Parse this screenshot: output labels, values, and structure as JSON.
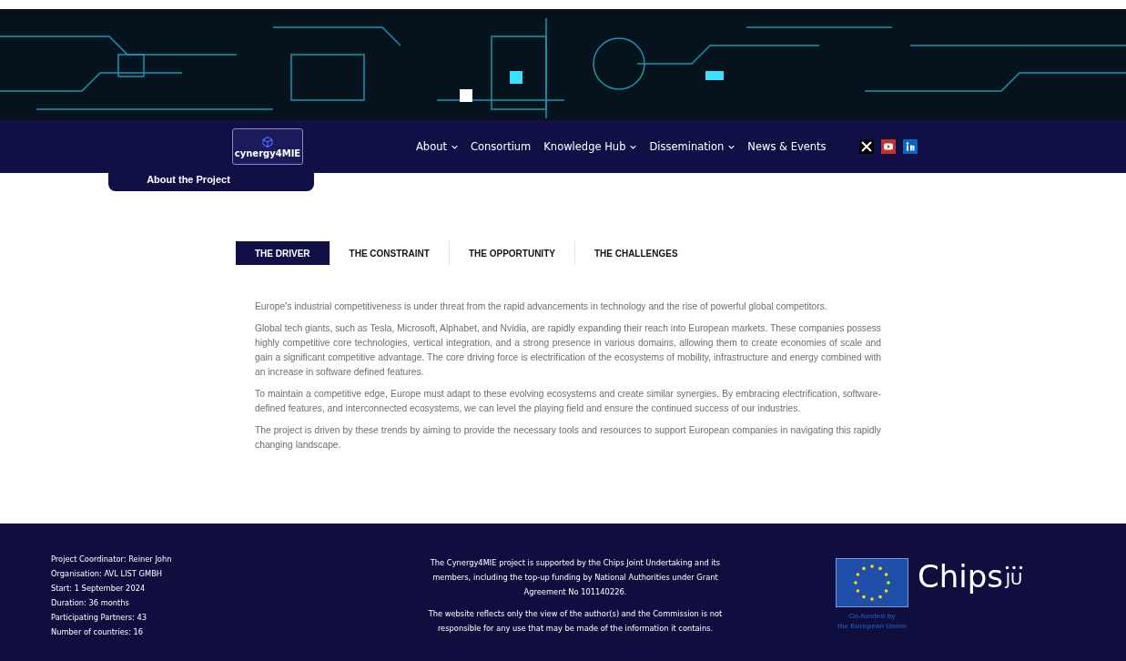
{
  "header": {
    "logo": "cynergy4MIE",
    "nav": [
      {
        "label": "About",
        "dropdown": true
      },
      {
        "label": "Consortium",
        "dropdown": false
      },
      {
        "label": "Knowledge Hub",
        "dropdown": true
      },
      {
        "label": "Dissemination",
        "dropdown": true
      },
      {
        "label": "News & Events",
        "dropdown": false
      }
    ],
    "social": [
      {
        "kind": "x",
        "color": "#000000"
      },
      {
        "kind": "youtube",
        "color": "#c4302b"
      },
      {
        "kind": "linkedin",
        "color": "#0a66c2"
      }
    ]
  },
  "page_tab": "About the Project",
  "tabs": [
    {
      "label": "THE DRIVER",
      "selected": true
    },
    {
      "label": "THE CONSTRAINT",
      "selected": false
    },
    {
      "label": "THE OPPORTUNITY",
      "selected": false
    },
    {
      "label": "THE CHALLENGES",
      "selected": false
    }
  ],
  "paragraphs": [
    "Europe's industrial competitiveness is under threat from the rapid advancements in technology and the rise of powerful global competitors.",
    "Global tech giants, such as Tesla, Microsoft, Alphabet, and Nvidia, are rapidly expanding their reach into European markets. These companies possess highly competitive core technologies, vertical integration, and a strong presence in various domains, allowing them to create economies of scale and gain a significant competitive advantage. The core driving force is electrification of the ecosystems of mobility, infrastructure and energy combined with an increase in software defined features.",
    "To maintain a competitive edge, Europe must adapt to these evolving ecosystems and create similar synergies. By embracing electrification, software-defined features, and interconnected ecosystems, we can level the playing field and ensure the continued success of our industries.",
    "The project is driven by these trends by aiming to provide the necessary tools and resources to support European companies in navigating this rapidly changing landscape."
  ],
  "footer": {
    "facts": [
      "Project Coordinator: Reiner John",
      "Organisation: AVL LIST GMBH",
      "Start: 1 September 2024",
      "Duration: 36 months",
      "Participating Partners: 43",
      "Number of countries: 16"
    ],
    "notices": [
      "The Cynergy4MIE project is supported by the Chips Joint Undertaking and its members, including the top-up funding by National Authorities under Grant Agreement No 101140226.",
      "The website reflects only the view of the author(s) and the Commission is not responsible for any use that may be made of the information it contains."
    ],
    "eu_caption": [
      "Co-funded by",
      "the European Union"
    ],
    "chips_logo": {
      "word": "Chips",
      "suffix": "JU"
    }
  }
}
